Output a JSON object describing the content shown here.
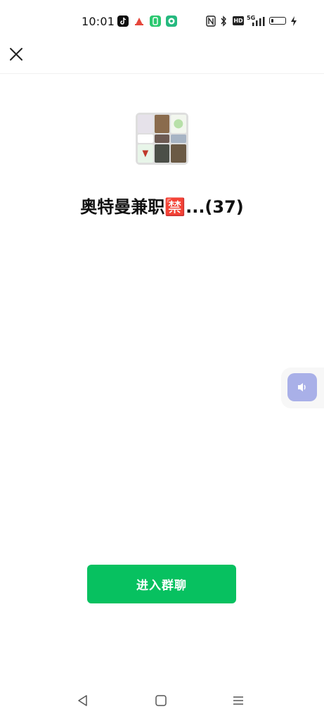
{
  "status_bar": {
    "time": "10:01",
    "icons": [
      "tiktok-icon",
      "app-a-icon",
      "app-b-icon",
      "app-c-icon",
      "nfc-icon",
      "bluetooth-icon",
      "hd-icon",
      "5g-signal-icon",
      "battery-icon",
      "charging-icon"
    ],
    "hd_label": "HD",
    "net_label": "5G"
  },
  "header": {
    "close_icon": "close-icon"
  },
  "group": {
    "name": "奥特曼兼职🈲...(37)",
    "avatar_cells": 9
  },
  "actions": {
    "join_label": "进入群聊"
  },
  "colors": {
    "accent": "#07c160",
    "float_button": "#a9b0e8"
  }
}
